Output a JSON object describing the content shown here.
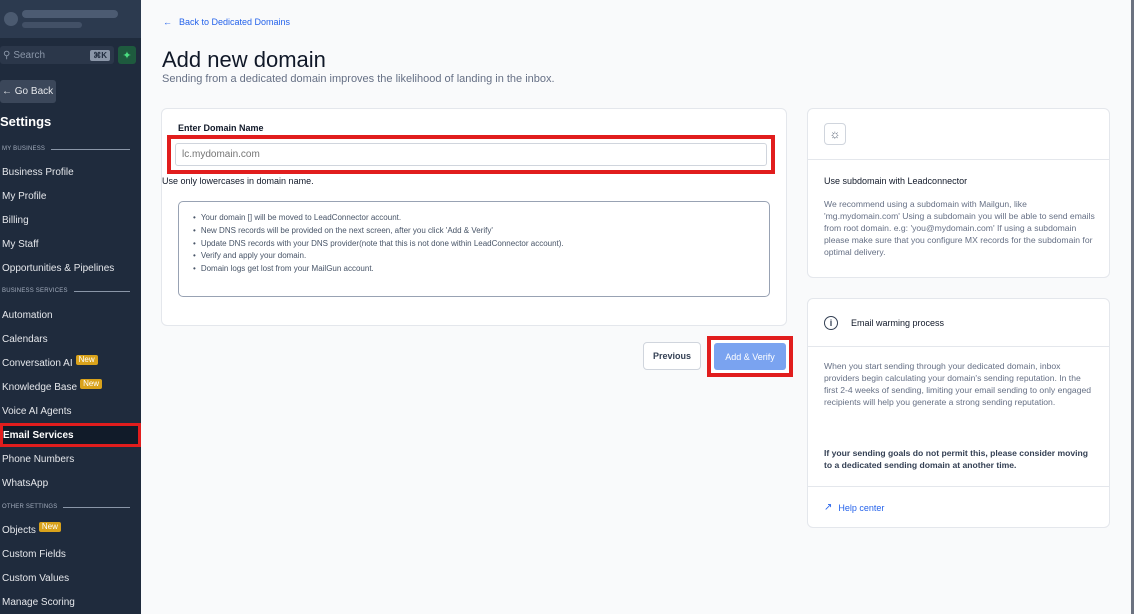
{
  "sidebar": {
    "search_placeholder": "Search",
    "search_shortcut": "⌘K",
    "go_back": "← Go Back",
    "title": "Settings",
    "sections": {
      "my_business": "MY BUSINESS",
      "business_services": "BUSINESS SERVICES",
      "other_settings": "OTHER SETTINGS"
    },
    "items": {
      "business_profile": "Business Profile",
      "my_profile": "My Profile",
      "billing": "Billing",
      "my_staff": "My Staff",
      "opportunities": "Opportunities & Pipelines",
      "automation": "Automation",
      "calendars": "Calendars",
      "conversation_ai": "Conversation AI",
      "knowledge_base": "Knowledge Base",
      "voice_ai": "Voice AI Agents",
      "email_services": "Email Services",
      "phone_numbers": "Phone Numbers",
      "whatsapp": "WhatsApp",
      "objects": "Objects",
      "custom_fields": "Custom Fields",
      "custom_values": "Custom Values",
      "manage_scoring": "Manage Scoring"
    },
    "new_badge": "New"
  },
  "main": {
    "back_link": "Back to Dedicated Domains",
    "title": "Add new domain",
    "subtitle": "Sending from a dedicated domain improves the likelihood of landing in the inbox.",
    "form": {
      "label": "Enter Domain Name",
      "placeholder": "lc.mydomain.com",
      "hint": "Use only lowercases in domain name.",
      "info": [
        "Your domain [] will be moved to LeadConnector account.",
        "New DNS records will be provided on the next screen, after you click 'Add & Verify'",
        "Update DNS records with your DNS provider(note that this is not done within LeadConnector account).",
        "Verify and apply your domain.",
        "Domain logs get lost from your MailGun account."
      ]
    },
    "buttons": {
      "previous": "Previous",
      "add_verify": "Add & Verify"
    }
  },
  "right": {
    "card1": {
      "title": "Use subdomain with Leadconnector",
      "body": "We recommend using a subdomain with Mailgun, like 'mg.mydomain.com' Using a subdomain you will be able to send emails from root domain. e.g: 'you@mydomain.com' If using a subdomain please make sure that you configure MX records for the subdomain for optimal delivery."
    },
    "card2": {
      "title": "Email warming process",
      "body": "When you start sending through your dedicated domain, inbox providers begin calculating your domain's sending reputation. In the first 2-4 weeks of sending, limiting your email sending to only engaged recipients will help you generate a strong sending reputation.",
      "bold": "If your sending goals do not permit this, please consider moving to a dedicated sending domain at another time.",
      "help": "Help center"
    }
  },
  "colors": {
    "sidebar_bg": "#1f2b3d",
    "accent": "#2563eb",
    "highlight": "#e11d1d",
    "badge": "#d9a21b"
  }
}
